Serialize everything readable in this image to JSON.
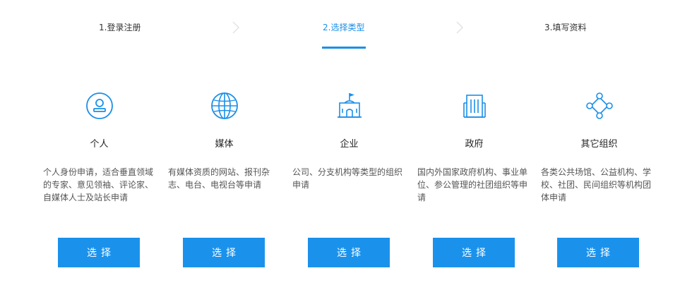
{
  "steps": [
    {
      "label": "1.登录注册"
    },
    {
      "label": "2.选择类型"
    },
    {
      "label": "3.填写资料"
    }
  ],
  "colors": {
    "accent": "#1a8fe8",
    "button_bg": "#1a92ec",
    "button_text": "#ffffff",
    "chevron": "#e3e3e3"
  },
  "cards": [
    {
      "icon": "person-icon",
      "title": "个人",
      "desc": "个人身份申请，适合垂直领域的专家、意见领袖、评论家、自媒体人士及站长申请",
      "button": "选择"
    },
    {
      "icon": "globe-icon",
      "title": "媒体",
      "desc": "有媒体资质的网站、报刊杂志、电台、电视台等申请",
      "button": "选择"
    },
    {
      "icon": "flag-building-icon",
      "title": "企业",
      "desc": "公司、分支机构等类型的组织申请",
      "button": "选择"
    },
    {
      "icon": "government-building-icon",
      "title": "政府",
      "desc": "国内外国家政府机构、事业单位、参公管理的社团组织等申请",
      "button": "选择"
    },
    {
      "icon": "network-nodes-icon",
      "title": "其它组织",
      "desc": "各类公共场馆、公益机构、学校、社团、民间组织等机构团体申请",
      "button": "选择"
    }
  ]
}
